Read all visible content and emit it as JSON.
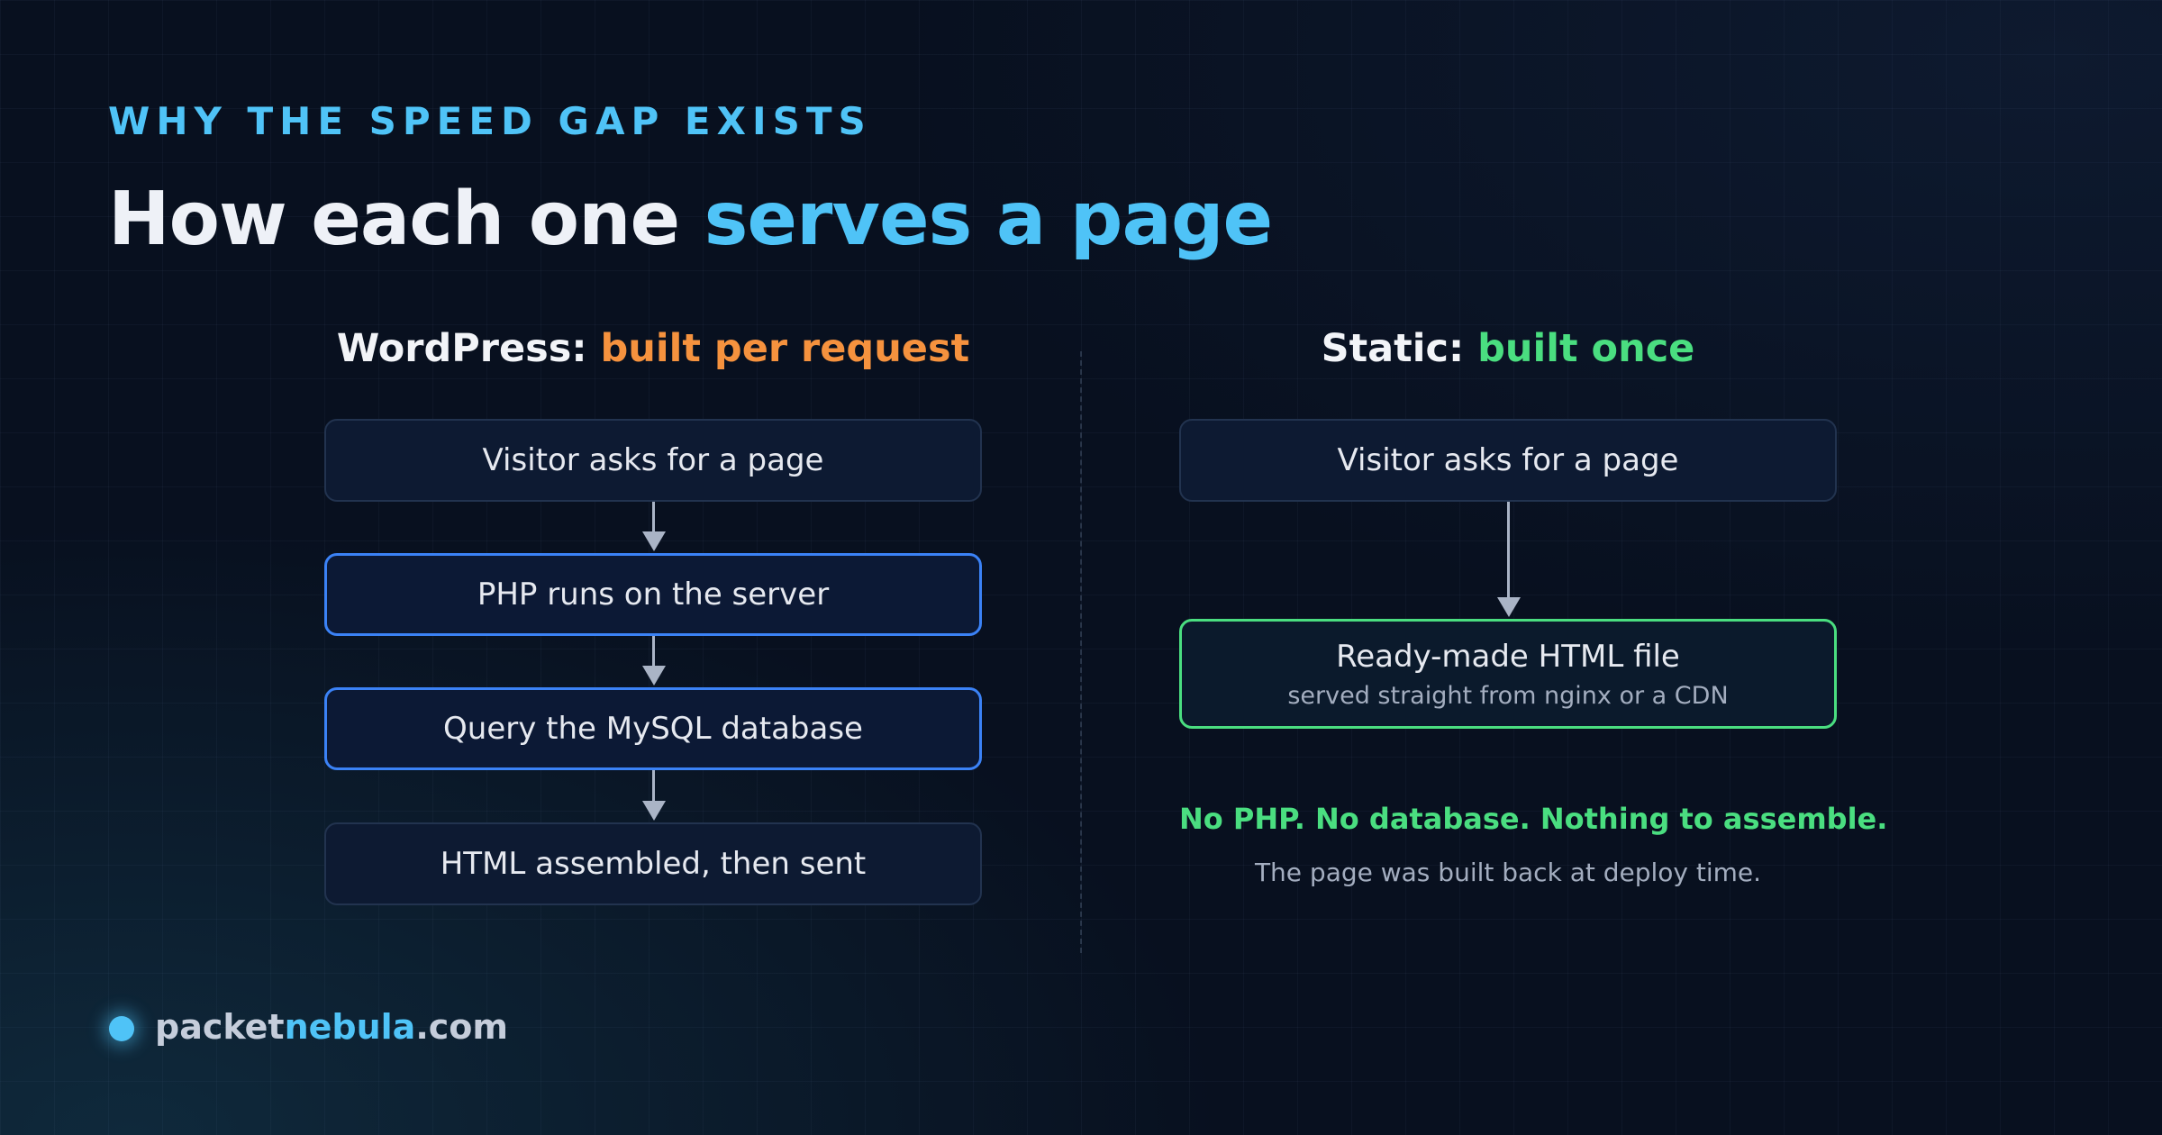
{
  "eyebrow": "WHY THE SPEED GAP EXISTS",
  "title": {
    "lead": "How each one ",
    "accent": "serves a page"
  },
  "wordpress": {
    "heading_lead": "WordPress: ",
    "heading_accent": "built per request",
    "steps": [
      "Visitor asks for a page",
      "PHP runs on the server",
      "Query the MySQL database",
      "HTML assembled, then sent"
    ]
  },
  "static": {
    "heading_lead": "Static: ",
    "heading_accent": "built once",
    "steps": [
      {
        "label": "Visitor asks for a page"
      },
      {
        "label": "Ready-made HTML file",
        "sub": "served straight from nginx or a CDN"
      }
    ],
    "note_primary": "No PHP. No database. Nothing to assemble.",
    "note_secondary": "The page was built back at deploy time."
  },
  "brand": {
    "lead": "packet",
    "mid": "nebula",
    "tail": ".com"
  },
  "colors": {
    "accent_cyan": "#4fc3f7",
    "accent_orange": "#f5923e",
    "accent_green": "#4ade80",
    "accent_blue": "#3b82f6",
    "background": "#08101f"
  }
}
